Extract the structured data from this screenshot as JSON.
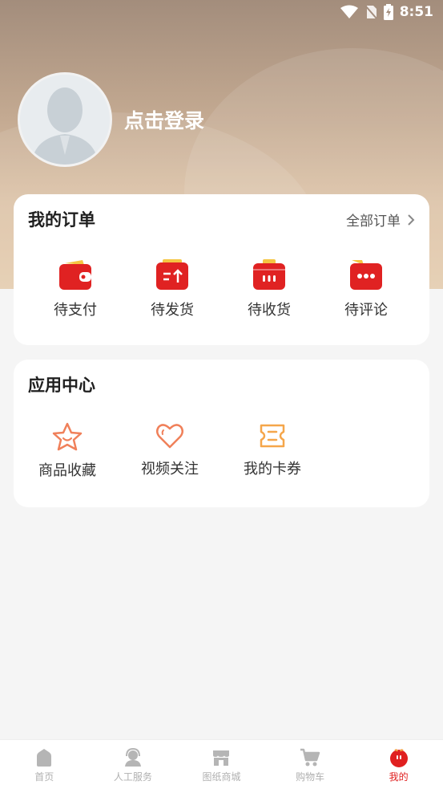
{
  "status_bar": {
    "time": "8:51"
  },
  "profile": {
    "login_label": "点击登录"
  },
  "orders": {
    "title": "我的订单",
    "all_orders_label": "全部订单",
    "items": [
      {
        "label": "待支付",
        "icon": "wallet-icon"
      },
      {
        "label": "待发货",
        "icon": "ship-box-icon"
      },
      {
        "label": "待收货",
        "icon": "receive-box-icon"
      },
      {
        "label": "待评论",
        "icon": "comment-icon"
      }
    ]
  },
  "apps": {
    "title": "应用中心",
    "items": [
      {
        "label": "商品收藏",
        "icon": "star-icon"
      },
      {
        "label": "视频关注",
        "icon": "heart-icon"
      },
      {
        "label": "我的卡券",
        "icon": "coupon-icon"
      }
    ]
  },
  "tabbar": {
    "items": [
      {
        "label": "首页",
        "icon": "home-icon"
      },
      {
        "label": "人工服务",
        "icon": "agent-icon"
      },
      {
        "label": "图纸商城",
        "icon": "store-icon"
      },
      {
        "label": "购物车",
        "icon": "cart-icon"
      },
      {
        "label": "我的",
        "icon": "me-icon",
        "active": true
      }
    ]
  },
  "colors": {
    "accent": "#e02020",
    "app_icon": "#f0805a",
    "coupon_icon": "#f5a64a"
  }
}
